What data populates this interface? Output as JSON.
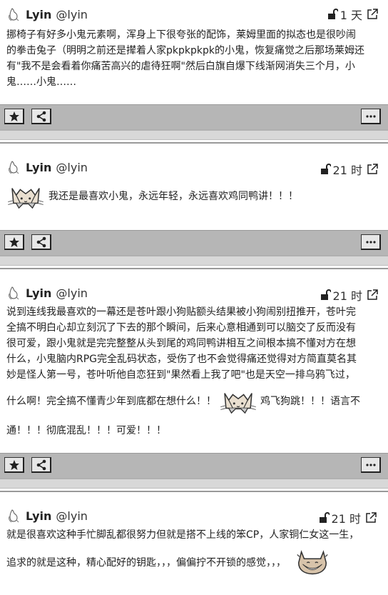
{
  "user": {
    "name": "Lyin",
    "handle": "@lyin"
  },
  "posts": [
    {
      "time": "1 天",
      "lines": [
        "挪椅子有好多小鬼元素啊，浑身上下很夸张的配饰，莱姆里面的拟态也是很吵闹",
        "的拳击兔子（明明之前还是撵着人家pkpkpkpk的小鬼，恢复痛觉之后那场莱姆还",
        "有\"我不是会看着你痛苦高兴的虐待狂啊\"然后白旗自爆下线渐网消失三个月，小",
        "鬼……小鬼……"
      ]
    },
    {
      "time": "21 时",
      "lines": [
        "我还是最喜欢小鬼，永远年轻，永远喜欢鸡同鸭讲！！！"
      ]
    },
    {
      "time": "21 时",
      "lines": [
        "说到连线我最喜欢的一幕还是苍叶跟小狗贴额头结果被小狗闹别扭推开，苍叶完",
        "全搞不明白心却立刻沉了下去的那个瞬间，后来心意相通到可以脑交了反而没有",
        "很可爱，跟小鬼就是完完整整从头到尾的鸡同鸭讲相互之间根本搞不懂对方在想",
        "什么，小鬼脑内RPG完全乱码状态，受伤了也不会觉得痛还觉得对方简直莫名其",
        "妙是怪人第一号，苍叶听他自恋狂到\"果然看上我了吧\"也是天空一排乌鸦飞过，"
      ],
      "line_with_sticker_before": "什么啊！完全搞不懂青少年到底都在想什么！！",
      "line_with_sticker_after": "鸡飞狗跳！！！语言不",
      "last_line": "通！！！彻底混乱！！！可爱！！！"
    },
    {
      "time": "21 时",
      "lines": [
        "就是很喜欢这种手忙脚乱都很努力但就是搭不上线的笨CP，人家铜仁女这一生，"
      ],
      "line_with_sticker": "追求的就是这种，精心配好的钥匙，，，偏偏拧不开锁的感觉，，，"
    }
  ],
  "icons": {
    "star": "star-icon",
    "share": "share-icon",
    "more": "more-icon",
    "lock": "unlock-icon",
    "external": "external-link-icon"
  }
}
